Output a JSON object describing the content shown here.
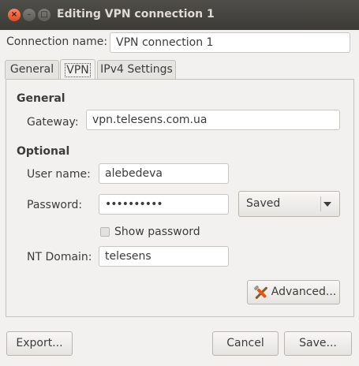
{
  "window": {
    "title": "Editing VPN connection 1",
    "close_glyph": "×",
    "minimize_glyph": "–",
    "maximize_glyph": "□"
  },
  "connection": {
    "name_label": "Connection name:",
    "name_value": "VPN connection 1"
  },
  "tabs": [
    {
      "label": "General",
      "active": false
    },
    {
      "label": "VPN",
      "active": true
    },
    {
      "label": "IPv4 Settings",
      "active": false
    }
  ],
  "general": {
    "heading": "General",
    "gateway_label": "Gateway:",
    "gateway_value": "vpn.telesens.com.ua"
  },
  "optional": {
    "heading": "Optional",
    "username_label": "User name:",
    "username_value": "alebedeva",
    "password_label": "Password:",
    "password_value": "••••••••••",
    "password_storage": "Saved",
    "show_password_label": "Show password",
    "show_password_checked": false,
    "ntdomain_label": "NT Domain:",
    "ntdomain_value": "telesens"
  },
  "buttons": {
    "advanced": "Advanced...",
    "export": "Export...",
    "cancel": "Cancel",
    "save": "Save..."
  },
  "icons": {
    "advanced": "tools-icon",
    "storage": "chevron-down-icon"
  }
}
